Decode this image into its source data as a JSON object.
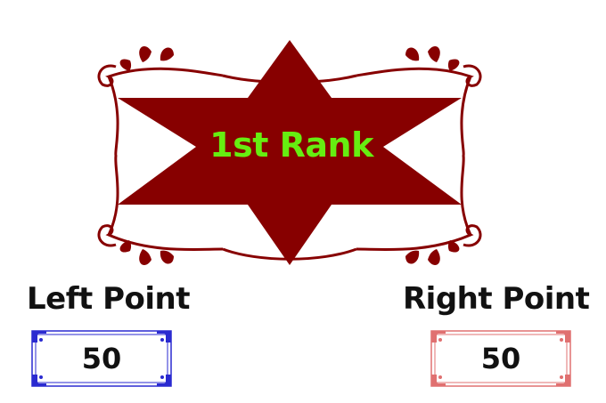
{
  "rank": {
    "label": "1st Rank"
  },
  "left": {
    "title": "Left Point",
    "value": "50"
  },
  "right": {
    "title": "Right Point",
    "value": "50"
  },
  "colors": {
    "emblem": "#870000",
    "rank_text": "#66ee11",
    "left_frame": "#2a2ad0",
    "right_frame": "#e07070"
  },
  "icons": [
    "star-emblem",
    "ornate-frame",
    "leaf-flourish"
  ]
}
